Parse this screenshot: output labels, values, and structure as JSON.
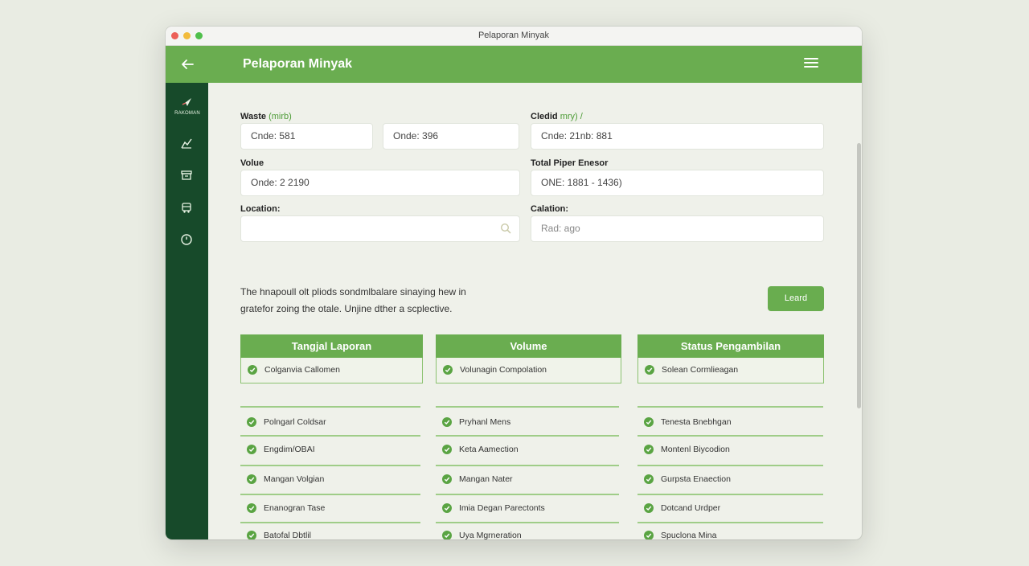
{
  "window": {
    "title": "Pelaporan Minyak"
  },
  "appbar": {
    "title": "Pelaporan Minyak",
    "back_icon": "arrow-left-icon",
    "menu_icon": "hamburger-menu-icon"
  },
  "sidebar": {
    "logo_text": "RAKOMAN",
    "items": [
      {
        "icon": "chart-icon"
      },
      {
        "icon": "box-icon"
      },
      {
        "icon": "truck-icon"
      },
      {
        "icon": "clock-icon"
      }
    ]
  },
  "form": {
    "waste": {
      "label": "Waste",
      "hint": "(mirb)",
      "value1": "Cnde: 581",
      "value2": "Onde: 396"
    },
    "credit": {
      "label": "Cledid",
      "hint": "mry) /",
      "value": "Cnde: 21nb: 881"
    },
    "volume": {
      "label": "Volue",
      "value": "Onde: 2 2190"
    },
    "total": {
      "label": "Total Piper Enesor",
      "value": "ONE: 1881 - 1436)"
    },
    "location": {
      "label": "Location:",
      "value": ""
    },
    "calation": {
      "label": "Calation:",
      "placeholder": "Rad: ago"
    }
  },
  "description": {
    "line1": "The hnapoull olt pliods sondmlbalare sinaying hew in",
    "line2": "gratefor zoing the otale. Unjine dther a scplective."
  },
  "load_button": {
    "label": "Leard"
  },
  "columns": [
    {
      "header": "Tangjal Laporan",
      "first": "Colganvia Callomen",
      "rows": [
        "Polngarl Coldsar",
        "Engdim/OBAI",
        "Mangan Volgian",
        "Enanogran Tase",
        "Batofal Dbtlil"
      ]
    },
    {
      "header": "Volume",
      "first": "Volunagin Compolation",
      "rows": [
        "Pryhanl Mens",
        "Keta Aamection",
        "Mangan Nater",
        "Imia Degan Parectonts",
        "Uya Mgrneration"
      ]
    },
    {
      "header": "Status Pengambilan",
      "first": "Solean Cormlieagan",
      "rows": [
        "Tenesta Bnebhgan",
        "Montenl Biycodion",
        "Gurpsta Enaection",
        "Dotcand Urdper",
        "Spuclona Mina"
      ]
    }
  ],
  "colors": {
    "primary_green": "#6aad50",
    "sidebar_green": "#174a2a",
    "check_green": "#5aa443"
  }
}
